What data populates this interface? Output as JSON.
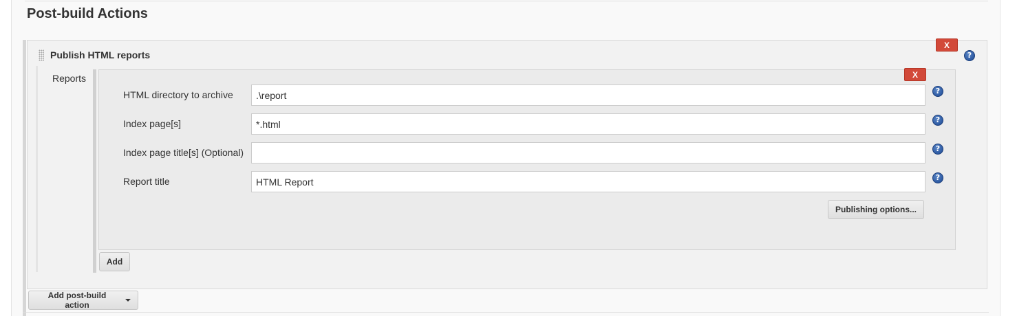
{
  "section": {
    "title": "Post-build Actions"
  },
  "plugin": {
    "title": "Publish HTML reports",
    "delete_label": "X",
    "help_glyph": "?"
  },
  "reports": {
    "label": "Reports",
    "entry_delete_label": "X",
    "fields": [
      {
        "label": "HTML directory to archive",
        "value": ".\\report",
        "help_glyph": "?"
      },
      {
        "label": "Index page[s]",
        "value": "*.html",
        "help_glyph": "?"
      },
      {
        "label": "Index page title[s] (Optional)",
        "value": "",
        "help_glyph": "?"
      },
      {
        "label": "Report title",
        "value": "HTML Report",
        "help_glyph": "?"
      }
    ],
    "publishing_options_label": "Publishing options...",
    "add_label": "Add"
  },
  "footer": {
    "add_post_build_label": "Add post-build action"
  },
  "icons": {
    "help": "help-icon",
    "drag": "drag-handle-icon",
    "dropdown": "chevron-down-icon"
  },
  "colors": {
    "delete_button": "#d24939",
    "help_icon": "#2d5aa3",
    "panel_background": "#f2f2f2"
  }
}
